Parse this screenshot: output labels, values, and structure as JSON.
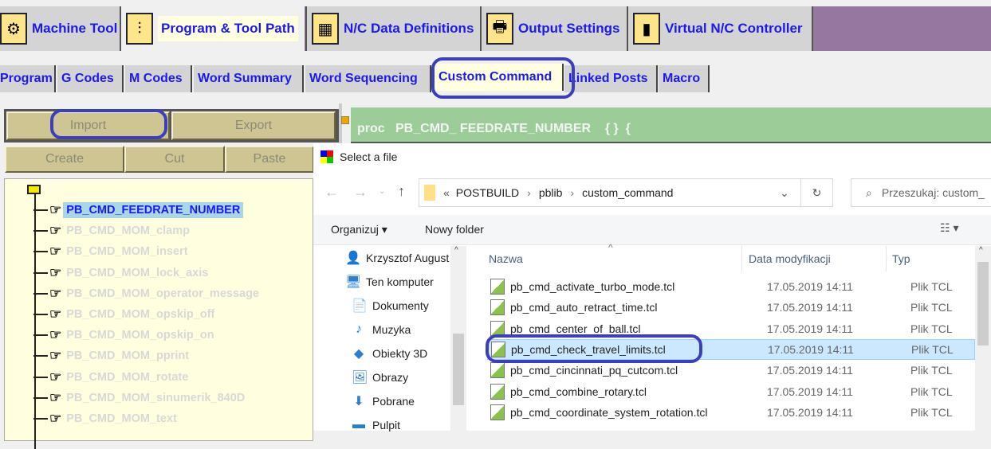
{
  "top_tabs": [
    {
      "label": "Machine Tool",
      "icon": "machine-tool-icon"
    },
    {
      "label": "Program & Tool Path",
      "icon": "program-tool-path-icon",
      "selected": true
    },
    {
      "label": "N/C Data Definitions",
      "icon": "nc-data-icon"
    },
    {
      "label": "Output Settings",
      "icon": "printer-icon"
    },
    {
      "label": "Virtual N/C Controller",
      "icon": "virtual-controller-icon"
    }
  ],
  "sub_tabs": [
    {
      "label": "Program"
    },
    {
      "label": "G Codes"
    },
    {
      "label": "M Codes"
    },
    {
      "label": "Word Summary"
    },
    {
      "label": "Word Sequencing"
    },
    {
      "label": "Custom Command",
      "selected": true
    },
    {
      "label": "Linked Posts"
    },
    {
      "label": "Macro"
    }
  ],
  "buttons": {
    "import": "Import",
    "export": "Export",
    "create": "Create",
    "cut": "Cut",
    "paste": "Paste"
  },
  "code_header": "proc   PB_CMD_ FEEDRATE_NUMBER    { }  {",
  "tree_items": [
    "PB_CMD_FEEDRATE_NUMBER",
    "PB_CMD_MOM_clamp",
    "PB_CMD_MOM_insert",
    "PB_CMD_MOM_lock_axis",
    "PB_CMD_MOM_operator_message",
    "PB_CMD_MOM_opskip_off",
    "PB_CMD_MOM_opskip_on",
    "PB_CMD_MOM_pprint",
    "PB_CMD_MOM_rotate",
    "PB_CMD_MOM_sinumerik_840D",
    "PB_CMD_MOM_text"
  ],
  "tree_selected": "PB_CMD_FEEDRATE_NUMBER",
  "dialog": {
    "title": "Select a file",
    "path": [
      "POSTBUILD",
      "pblib",
      "custom_command"
    ],
    "path_prefix": "«",
    "search_placeholder": "Przeszukaj: custom_",
    "organize": "Organizuj ▾",
    "new_folder": "Nowy folder",
    "nav_items": [
      {
        "label": "Krzysztof August",
        "icon": "user-icon"
      },
      {
        "label": "Ten komputer",
        "icon": "computer-icon"
      },
      {
        "label": "Dokumenty",
        "icon": "documents-icon"
      },
      {
        "label": "Muzyka",
        "icon": "music-icon"
      },
      {
        "label": "Obiekty 3D",
        "icon": "3d-objects-icon"
      },
      {
        "label": "Obrazy",
        "icon": "pictures-icon"
      },
      {
        "label": "Pobrane",
        "icon": "downloads-icon"
      },
      {
        "label": "Pulpit",
        "icon": "desktop-icon"
      }
    ],
    "columns": {
      "name": "Nazwa",
      "date": "Data modyfikacji",
      "type": "Typ"
    },
    "files": [
      {
        "name": "pb_cmd_activate_turbo_mode.tcl",
        "date": "17.05.2019 14:11",
        "type": "Plik TCL"
      },
      {
        "name": "pb_cmd_auto_retract_time.tcl",
        "date": "17.05.2019 14:11",
        "type": "Plik TCL"
      },
      {
        "name": "pb_cmd_center_of_ball.tcl",
        "date": "17.05.2019 14:11",
        "type": "Plik TCL"
      },
      {
        "name": "pb_cmd_check_travel_limits.tcl",
        "date": "17.05.2019 14:11",
        "type": "Plik TCL",
        "selected": true
      },
      {
        "name": "pb_cmd_cincinnati_pq_cutcom.tcl",
        "date": "17.05.2019 14:11",
        "type": "Plik TCL"
      },
      {
        "name": "pb_cmd_combine_rotary.tcl",
        "date": "17.05.2019 14:11",
        "type": "Plik TCL"
      },
      {
        "name": "pb_cmd_coordinate_system_rotation.tcl",
        "date": "17.05.2019 14:11",
        "type": "Plik TCL"
      }
    ]
  },
  "colors": {
    "accent_text": "#1a1aee",
    "annotation": "#3b3fbf",
    "code_bar": "#9ccc98",
    "button": "#cfc593",
    "tree_bg": "#ffffe0",
    "selection": "#cce8ff",
    "header_bg": "#9677a0"
  }
}
